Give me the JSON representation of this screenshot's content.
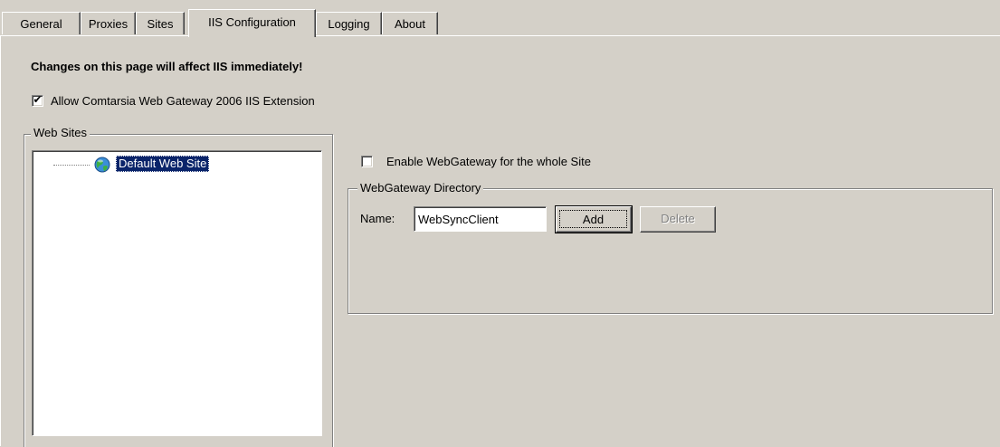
{
  "tabs": [
    {
      "label": "General"
    },
    {
      "label": "Proxies"
    },
    {
      "label": "Sites"
    },
    {
      "label": "IIS Configuration",
      "active": true
    },
    {
      "label": "Logging"
    },
    {
      "label": "About"
    }
  ],
  "page": {
    "warning": "Changes on this page will affect IIS immediately!",
    "allow_extension": {
      "label": "Allow Comtarsia Web Gateway 2006 IIS Extension",
      "checked": true
    }
  },
  "web_sites": {
    "title": "Web Sites",
    "items": [
      {
        "label": "Default Web Site",
        "icon": "globe-icon",
        "selected": true
      }
    ]
  },
  "site_options": {
    "enable_whole_site": {
      "label": "Enable WebGateway for the whole Site",
      "checked": false
    }
  },
  "directory": {
    "title": "WebGateway Directory",
    "name_label": "Name:",
    "name_value": "WebSyncClient",
    "add_label": "Add",
    "delete_label": "Delete"
  },
  "colors": {
    "background": "#d4d0c8",
    "selection": "#0a246a"
  }
}
